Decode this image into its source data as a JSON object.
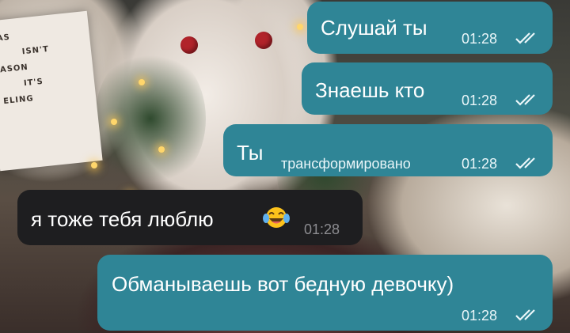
{
  "chat": {
    "messages": [
      {
        "direction": "out",
        "text": "Слушай ты",
        "time": "01:28",
        "status_icon": "double-check-icon"
      },
      {
        "direction": "out",
        "text": "Знаешь кто",
        "time": "01:28",
        "status_icon": "double-check-icon"
      },
      {
        "direction": "out",
        "text": "Ты",
        "edited_label": "трансформировано",
        "time": "01:28",
        "status_icon": "double-check-icon"
      },
      {
        "direction": "in",
        "text": "я тоже тебя люблю",
        "emoji": "face-with-tears-of-joy",
        "time": "01:28"
      },
      {
        "direction": "out",
        "text": "Обманываешь вот бедную девочку)",
        "time": "01:28",
        "status_icon": "double-check-icon"
      }
    ]
  },
  "wallpaper": {
    "sign_lines": [
      "AS",
      "ISN'T",
      "ASON",
      "IT'S",
      "ELING"
    ]
  },
  "colors": {
    "outgoing_bubble": "#2f8596",
    "incoming_bubble": "#1e1e20",
    "meta_outgoing": "#eaf6f9",
    "meta_incoming": "#8c8c90"
  }
}
